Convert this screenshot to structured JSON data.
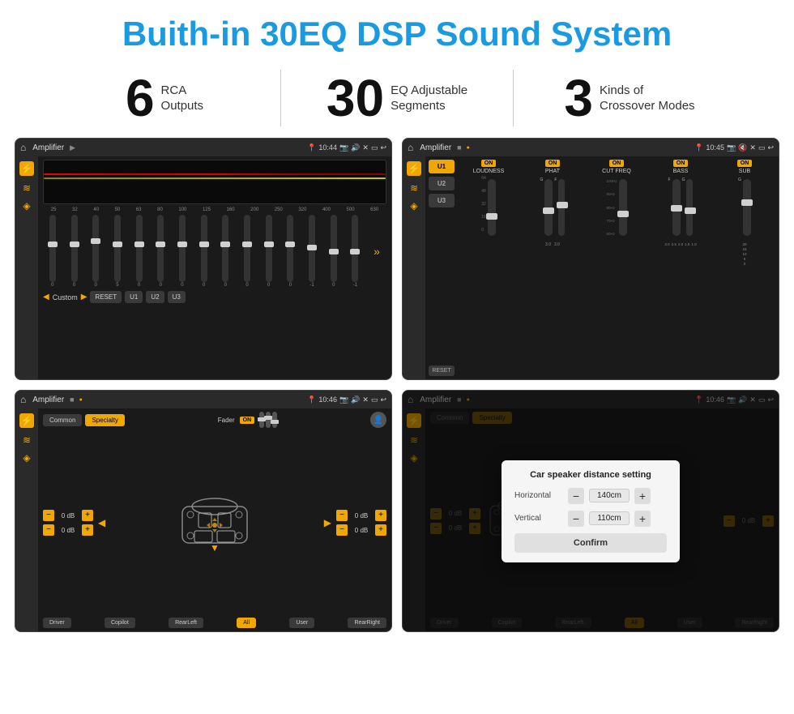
{
  "page": {
    "title": "Buith-in 30EQ DSP Sound System",
    "title_color": "#1a9ae0"
  },
  "stats": [
    {
      "number": "6",
      "text": "RCA\nOutputs"
    },
    {
      "number": "30",
      "text": "EQ Adjustable\nSegments"
    },
    {
      "number": "3",
      "text": "Kinds of\nCrossover Modes"
    }
  ],
  "screens": {
    "top_left": {
      "status": {
        "title": "Amplifier",
        "time": "10:44"
      },
      "eq_freqs": [
        "25",
        "32",
        "40",
        "50",
        "63",
        "80",
        "100",
        "125",
        "160",
        "200",
        "250",
        "320",
        "400",
        "500",
        "630"
      ],
      "preset_label": "Custom",
      "buttons": [
        "RESET",
        "U1",
        "U2",
        "U3"
      ]
    },
    "top_right": {
      "status": {
        "title": "Amplifier",
        "time": "10:45"
      },
      "presets": [
        "U1",
        "U2",
        "U3"
      ],
      "reset_label": "RESET",
      "controls": [
        {
          "label": "LOUDNESS",
          "toggle": "ON"
        },
        {
          "label": "PHAT",
          "toggle": "ON"
        },
        {
          "label": "CUT FREQ",
          "toggle": "ON"
        },
        {
          "label": "BASS",
          "toggle": "ON"
        },
        {
          "label": "SUB",
          "toggle": "ON"
        }
      ]
    },
    "bottom_left": {
      "status": {
        "title": "Amplifier",
        "time": "10:46"
      },
      "tabs": [
        "Common",
        "Specialty"
      ],
      "fader_label": "Fader",
      "fader_toggle": "ON",
      "vol_rows": [
        {
          "value": "0 dB"
        },
        {
          "value": "0 dB"
        },
        {
          "value": "0 dB"
        },
        {
          "value": "0 dB"
        }
      ],
      "bottom_buttons": [
        "Driver",
        "Copilot",
        "RearLeft",
        "All",
        "User",
        "RearRight"
      ]
    },
    "bottom_right": {
      "status": {
        "title": "Amplifier",
        "time": "10:46"
      },
      "tabs": [
        "Common",
        "Specialty"
      ],
      "dialog": {
        "title": "Car speaker distance setting",
        "horizontal_label": "Horizontal",
        "horizontal_value": "140cm",
        "vertical_label": "Vertical",
        "vertical_value": "110cm",
        "confirm_label": "Confirm"
      },
      "vol_rows": [
        {
          "value": "0 dB"
        },
        {
          "value": "0 dB"
        }
      ],
      "bottom_buttons": [
        "Driver",
        "Copilot",
        "RearLeft",
        "All",
        "User",
        "RearRight"
      ]
    }
  }
}
